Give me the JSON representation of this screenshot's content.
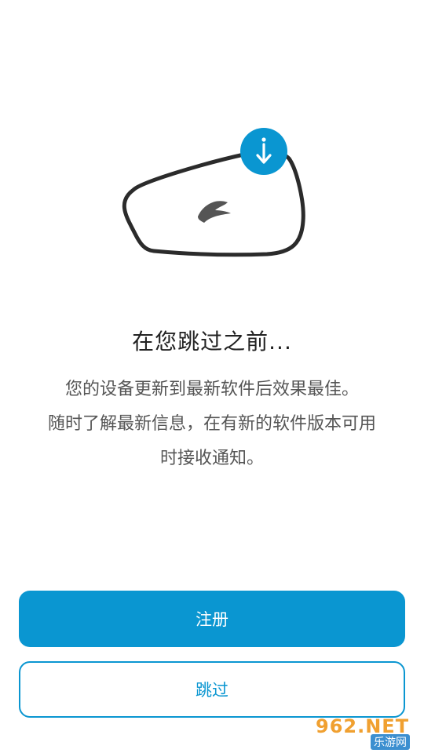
{
  "content": {
    "title": "在您跳过之前...",
    "description_lines": [
      "您的设备更新到最新软件后效果最佳。",
      "随时了解最新信息，在有新的软件版本可用",
      "时接收通知。"
    ]
  },
  "illustration": {
    "device_icon": "headset-device-outline",
    "badge_icon": "download-arrow-icon",
    "accent_color": "#0a96d1"
  },
  "buttons": {
    "register_label": "注册",
    "skip_label": "跳过"
  },
  "watermark": {
    "brand": "962.NET",
    "site": "乐游网"
  }
}
